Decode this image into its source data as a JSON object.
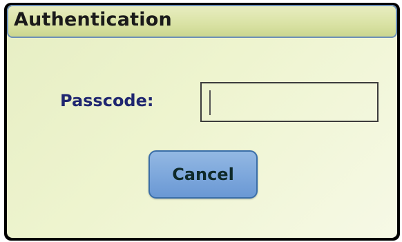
{
  "dialog": {
    "title": "Authentication",
    "passcode_label": "Passcode:",
    "passcode_value": "",
    "cancel_label": "Cancel"
  }
}
